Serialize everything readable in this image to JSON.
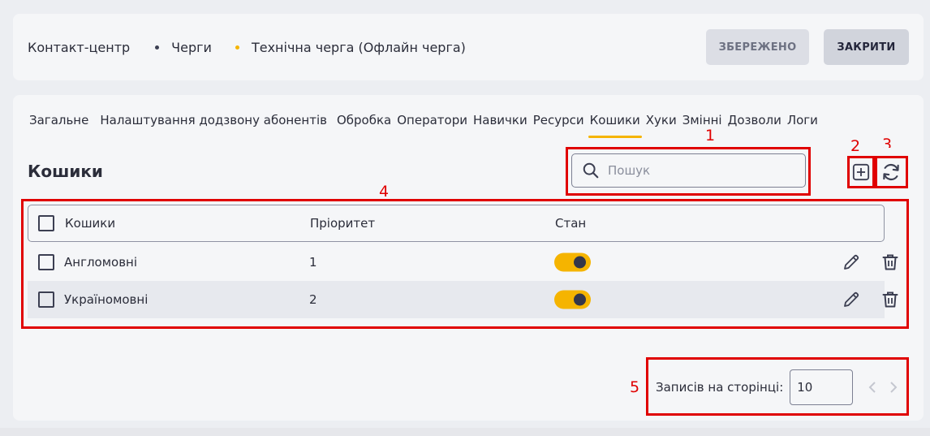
{
  "breadcrumb": [
    "Контакт-центр",
    "Черги",
    "Технічна черга (Офлайн черга)"
  ],
  "header_buttons": {
    "saved": "ЗБЕРЕЖЕНО",
    "close": "ЗАКРИТИ"
  },
  "tabs": [
    {
      "label": "Загальне",
      "active": false
    },
    {
      "label": "Налаштування додзвону абонентів",
      "active": false
    },
    {
      "label": "Обробка",
      "active": false
    },
    {
      "label": "Оператори",
      "active": false
    },
    {
      "label": "Навички",
      "active": false
    },
    {
      "label": "Ресурси",
      "active": false
    },
    {
      "label": "Кошики",
      "active": true
    },
    {
      "label": "Хуки",
      "active": false
    },
    {
      "label": "Змінні",
      "active": false
    },
    {
      "label": "Дозволи",
      "active": false
    },
    {
      "label": "Логи",
      "active": false
    }
  ],
  "section_title": "Кошики",
  "search": {
    "placeholder": "Пошук",
    "value": ""
  },
  "table": {
    "columns": [
      "Кошики",
      "Пріоритет",
      "Стан"
    ],
    "rows": [
      {
        "name": "Англомовні",
        "priority": "1",
        "enabled": true
      },
      {
        "name": "Україномовні",
        "priority": "2",
        "enabled": true
      }
    ]
  },
  "pagination": {
    "label": "Записів на сторінці:",
    "per_page": "10"
  },
  "annotations": [
    "1",
    "2",
    "3",
    "4",
    "5"
  ],
  "colors": {
    "accent": "#f5b400",
    "annotation": "#e00000"
  },
  "icons": [
    "search-icon",
    "add-icon",
    "refresh-icon",
    "edit-icon",
    "trash-icon",
    "chevron-left-icon",
    "chevron-right-icon"
  ]
}
